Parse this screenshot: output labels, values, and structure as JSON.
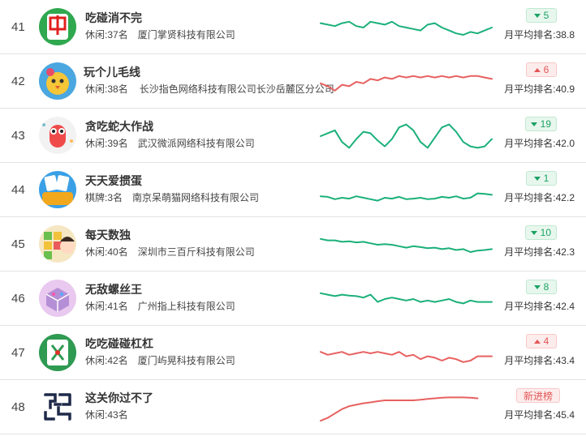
{
  "rows": [
    {
      "rank": "41",
      "name": "吃碰消不完",
      "category": "休闲:37名",
      "developer": "厦门掌贤科技有限公司",
      "change": "5",
      "change_dir": "down",
      "avg": "月平均排名:38.8",
      "trend_color": "#1bb07a",
      "trend": [
        0.35,
        0.4,
        0.45,
        0.35,
        0.3,
        0.45,
        0.5,
        0.3,
        0.35,
        0.4,
        0.3,
        0.45,
        0.5,
        0.55,
        0.6,
        0.4,
        0.35,
        0.5,
        0.6,
        0.7,
        0.75,
        0.65,
        0.7,
        0.6,
        0.5
      ]
    },
    {
      "rank": "42",
      "name": "玩个儿毛线",
      "category": "休闲:38名",
      "developer": "长沙指色网络科技有限公司长沙岳麓区分公司",
      "change": "6",
      "change_dir": "up",
      "avg": "月平均排名:40.9",
      "trend_color": "#e86060",
      "trend": [
        0.55,
        0.65,
        0.8,
        0.6,
        0.65,
        0.5,
        0.55,
        0.4,
        0.45,
        0.35,
        0.4,
        0.3,
        0.35,
        0.3,
        0.35,
        0.3,
        0.35,
        0.3,
        0.35,
        0.3,
        0.35,
        0.3,
        0.3,
        0.35,
        0.4
      ]
    },
    {
      "rank": "43",
      "name": "贪吃蛇大作战",
      "category": "休闲:39名",
      "developer": "武汉微派网络科技有限公司",
      "change": "19",
      "change_dir": "down",
      "avg": "月平均排名:42.0",
      "trend_color": "#1bb07a",
      "trend": [
        0.5,
        0.4,
        0.3,
        0.7,
        0.9,
        0.6,
        0.35,
        0.4,
        0.65,
        0.85,
        0.6,
        0.2,
        0.1,
        0.3,
        0.7,
        0.9,
        0.55,
        0.2,
        0.1,
        0.35,
        0.7,
        0.85,
        0.9,
        0.85,
        0.6
      ]
    },
    {
      "rank": "44",
      "name": "天天爱掼蛋",
      "category": "棋牌:3名",
      "developer": "南京呆萌猫网络科技有限公司",
      "change": "1",
      "change_dir": "down",
      "avg": "月平均排名:42.2",
      "trend_color": "#1bb07a",
      "trend": [
        0.7,
        0.72,
        0.8,
        0.75,
        0.78,
        0.7,
        0.75,
        0.8,
        0.85,
        0.75,
        0.78,
        0.72,
        0.8,
        0.78,
        0.75,
        0.8,
        0.78,
        0.72,
        0.75,
        0.7,
        0.78,
        0.75,
        0.6,
        0.62,
        0.65
      ]
    },
    {
      "rank": "45",
      "name": "每天数独",
      "category": "休闲:40名",
      "developer": "深圳市三百斤科技有限公司",
      "change": "10",
      "change_dir": "down",
      "avg": "月平均排名:42.3",
      "trend_color": "#1bb07a",
      "trend": [
        0.3,
        0.35,
        0.35,
        0.4,
        0.38,
        0.42,
        0.4,
        0.45,
        0.5,
        0.48,
        0.5,
        0.55,
        0.6,
        0.55,
        0.58,
        0.62,
        0.6,
        0.65,
        0.62,
        0.68,
        0.65,
        0.75,
        0.7,
        0.68,
        0.65
      ]
    },
    {
      "rank": "46",
      "name": "无敌螺丝王",
      "category": "休闲:41名",
      "developer": "广州指上科技有限公司",
      "change": "8",
      "change_dir": "down",
      "avg": "月平均排名:42.4",
      "trend_color": "#1bb07a",
      "trend": [
        0.3,
        0.35,
        0.4,
        0.35,
        0.38,
        0.4,
        0.45,
        0.35,
        0.6,
        0.5,
        0.45,
        0.5,
        0.55,
        0.5,
        0.6,
        0.55,
        0.6,
        0.55,
        0.5,
        0.6,
        0.65,
        0.55,
        0.6,
        0.6,
        0.6
      ]
    },
    {
      "rank": "47",
      "name": "吃吃碰碰杠杠",
      "category": "休闲:42名",
      "developer": "厦门屿晃科技有限公司",
      "change": "4",
      "change_dir": "up",
      "avg": "月平均排名:43.4",
      "trend_color": "#e86060",
      "trend": [
        0.45,
        0.55,
        0.5,
        0.45,
        0.55,
        0.5,
        0.45,
        0.5,
        0.45,
        0.5,
        0.55,
        0.45,
        0.6,
        0.55,
        0.7,
        0.6,
        0.65,
        0.75,
        0.65,
        0.7,
        0.8,
        0.75,
        0.6,
        0.6,
        0.6
      ]
    },
    {
      "rank": "48",
      "name": "这关你过不了",
      "category": "休闲:43名",
      "developer": "",
      "change": "新进榜",
      "change_dir": "new",
      "avg": "月平均排名:45.4",
      "trend_color": "#e86060",
      "trend": [
        0.95,
        0.85,
        0.7,
        0.55,
        0.45,
        0.4,
        0.35,
        0.32,
        0.28,
        0.25,
        0.25,
        0.25,
        0.25,
        0.25,
        0.23,
        0.2,
        0.18,
        0.16,
        0.15,
        0.15,
        0.15,
        0.16,
        0.18,
        null,
        null
      ]
    }
  ]
}
